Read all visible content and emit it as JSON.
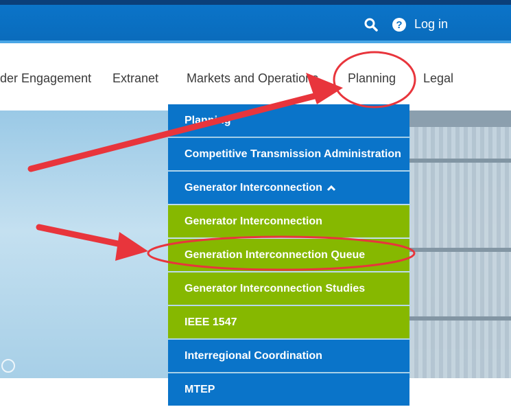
{
  "header": {
    "login_label": "Log in",
    "help_symbol": "?"
  },
  "nav": {
    "items": [
      {
        "label": "lder Engagement"
      },
      {
        "label": "Extranet"
      },
      {
        "label": "Markets and Operations"
      },
      {
        "label": "Planning"
      },
      {
        "label": "Legal"
      }
    ]
  },
  "dropdown": {
    "items": [
      {
        "label": "Planning",
        "style": "blue"
      },
      {
        "label": "Competitive Transmission Administration",
        "style": "blue"
      },
      {
        "label": "Generator Interconnection",
        "style": "blue",
        "expanded": true
      },
      {
        "label": "Generator Interconnection",
        "style": "green"
      },
      {
        "label": "Generation Interconnection Queue",
        "style": "green"
      },
      {
        "label": "Generator Interconnection Studies",
        "style": "green"
      },
      {
        "label": "IEEE 1547",
        "style": "green"
      },
      {
        "label": "Interregional Coordination",
        "style": "blue"
      },
      {
        "label": "MTEP",
        "style": "blue"
      }
    ]
  },
  "colors": {
    "header_blue": "#0a6bbb",
    "menu_blue": "#0a74c9",
    "menu_green": "#86b800",
    "annotation_red": "#e8353c"
  }
}
